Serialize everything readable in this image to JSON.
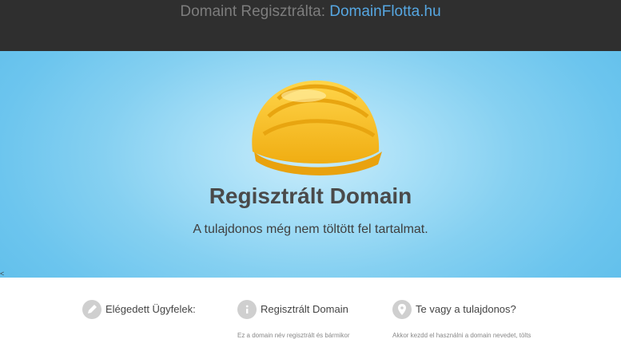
{
  "header": {
    "title_prefix": "Domaint Regisztrálta:",
    "title_brand": "DomainFlotta.hu"
  },
  "hero": {
    "icon": "hard-hat-icon",
    "title": "Regisztrált Domain",
    "subtitle": "A tulajdonos még nem töltött fel tartalmat.",
    "caret": "<"
  },
  "features": [
    {
      "icon": "pencil-icon",
      "title": "Elégedett Ügyfelek:",
      "text": ""
    },
    {
      "icon": "info-icon",
      "title": "Regisztrált Domain",
      "text": "Ez a domain név regisztrált és bármikor"
    },
    {
      "icon": "location-pin-icon",
      "title": "Te vagy a tulajdonos?",
      "text": "Akkor kezdd el használni a domain nevedet, tölts"
    }
  ],
  "colors": {
    "topbar": "#2f2f2f",
    "brand": "#56a7e2",
    "hero": "#6cc5ee",
    "helmet": "#f7c42e"
  }
}
